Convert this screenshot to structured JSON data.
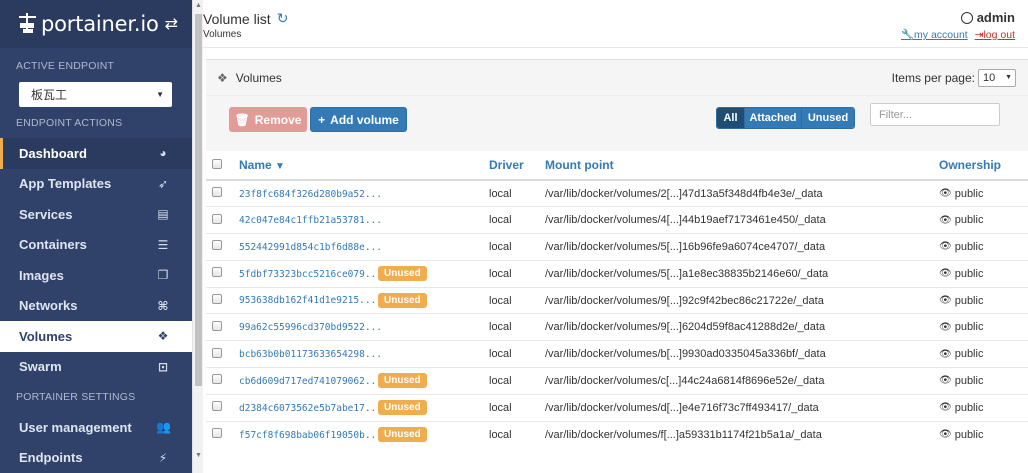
{
  "brand": {
    "name": "portainer.io"
  },
  "sidebar": {
    "active_endpoint_title": "ACTIVE ENDPOINT",
    "endpoint_value": "板瓦工",
    "endpoint_actions_title": "ENDPOINT ACTIONS",
    "items": [
      {
        "label": "Dashboard",
        "icon": "tachometer-icon"
      },
      {
        "label": "App Templates",
        "icon": "rocket-icon"
      },
      {
        "label": "Services",
        "icon": "list-alt-icon"
      },
      {
        "label": "Containers",
        "icon": "server-icon"
      },
      {
        "label": "Images",
        "icon": "clone-icon"
      },
      {
        "label": "Networks",
        "icon": "sitemap-icon"
      },
      {
        "label": "Volumes",
        "icon": "cubes-icon"
      },
      {
        "label": "Swarm",
        "icon": "object-group-icon"
      }
    ],
    "settings_title": "PORTAINER SETTINGS",
    "settings_items": [
      {
        "label": "User management",
        "icon": "users-icon"
      },
      {
        "label": "Endpoints",
        "icon": "plug-icon"
      }
    ]
  },
  "header": {
    "title": "Volume list",
    "breadcrumb": "Volumes",
    "user": "admin",
    "my_account": "my account",
    "log_out": "log out"
  },
  "widget": {
    "title": "Volumes",
    "items_per_page_label": "Items per page:",
    "items_per_page_value": "10",
    "remove_label": "Remove",
    "add_label": "Add volume",
    "filter_all": "All",
    "filter_attached": "Attached",
    "filter_unused": "Unused",
    "filter_placeholder": "Filter..."
  },
  "table": {
    "columns": {
      "name": "Name",
      "driver": "Driver",
      "mount": "Mount point",
      "ownership": "Ownership"
    },
    "rows": [
      {
        "name": "23f8fc684f326d280b9a52...",
        "unused": false,
        "driver": "local",
        "mount": "/var/lib/docker/volumes/2[...]47d13a5f348d4fb4e3e/_data",
        "ownership": "public"
      },
      {
        "name": "42c047e84c1ffb21a53781...",
        "unused": false,
        "driver": "local",
        "mount": "/var/lib/docker/volumes/4[...]44b19aef7173461e450/_data",
        "ownership": "public"
      },
      {
        "name": "552442991d854c1bf6d88e...",
        "unused": false,
        "driver": "local",
        "mount": "/var/lib/docker/volumes/5[...]16b96fe9a6074ce4707/_data",
        "ownership": "public"
      },
      {
        "name": "5fdbf73323bcc5216ce079...",
        "unused": true,
        "driver": "local",
        "mount": "/var/lib/docker/volumes/5[...]a1e8ec38835b2146e60/_data",
        "ownership": "public"
      },
      {
        "name": "953638db162f41d1e9215...",
        "unused": true,
        "driver": "local",
        "mount": "/var/lib/docker/volumes/9[...]92c9f42bec86c21722e/_data",
        "ownership": "public"
      },
      {
        "name": "99a62c55996cd370bd9522...",
        "unused": false,
        "driver": "local",
        "mount": "/var/lib/docker/volumes/9[...]6204d59f8ac41288d2e/_data",
        "ownership": "public"
      },
      {
        "name": "bcb63b0b01173633654298...",
        "unused": false,
        "driver": "local",
        "mount": "/var/lib/docker/volumes/b[...]9930ad0335045a336bf/_data",
        "ownership": "public"
      },
      {
        "name": "cb6d609d717ed741079062...",
        "unused": true,
        "driver": "local",
        "mount": "/var/lib/docker/volumes/c[...]44c24a6814f8696e52e/_data",
        "ownership": "public"
      },
      {
        "name": "d2384c6073562e5b7abe17...",
        "unused": true,
        "driver": "local",
        "mount": "/var/lib/docker/volumes/d[...]e4e716f73c7ff493417/_data",
        "ownership": "public"
      },
      {
        "name": "f57cf8f698bab06f19050b...",
        "unused": true,
        "driver": "local",
        "mount": "/var/lib/docker/volumes/f[...]a59331b1174f21b5a1a/_data",
        "ownership": "public"
      }
    ],
    "unused_badge": "Unused"
  },
  "colors": {
    "sidebar": "#30426a",
    "accent": "#337ab7",
    "warning": "#f0ad4e",
    "danger": "#d9534f"
  }
}
